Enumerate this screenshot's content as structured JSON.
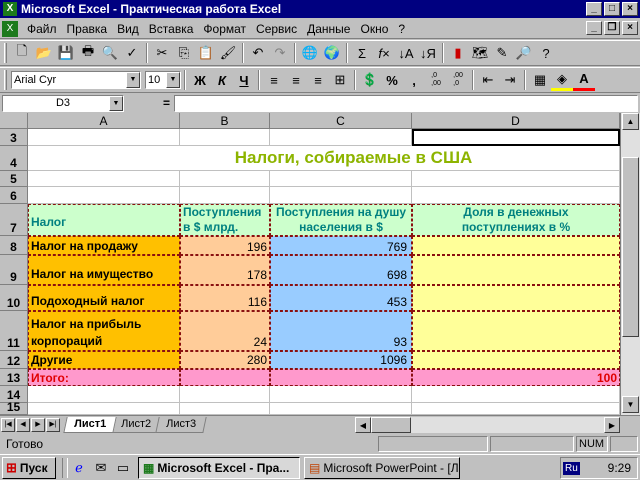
{
  "window": {
    "title": "Microsoft Excel - Практическая работа Excel",
    "app_icon": "excel-icon"
  },
  "menu": [
    "Файл",
    "Правка",
    "Вид",
    "Вставка",
    "Формат",
    "Сервис",
    "Данные",
    "Окно",
    "?"
  ],
  "format_bar": {
    "font": "Arial Cyr",
    "size": "10",
    "bold": "Ж",
    "italic": "К",
    "underline": "Ч",
    "percent": "%",
    "thousands": ",",
    "inc_dec": ",0\n,00",
    "dec_dec": ",00\n,0"
  },
  "formula_bar": {
    "name_box": "D3",
    "equals": "=",
    "value": ""
  },
  "columns": [
    "A",
    "B",
    "C",
    "D"
  ],
  "rows": [
    "3",
    "4",
    "5",
    "6",
    "7",
    "8",
    "9",
    "10",
    "11",
    "12",
    "13",
    "14",
    "15"
  ],
  "sheet": {
    "title": "Налоги, собираемые в США",
    "headers": [
      "Налог",
      "Поступления в $ млрд.",
      "Поступления на душу населения в $",
      "Доля в денежных поступлениях в %"
    ],
    "data": [
      {
        "name": "Налог на продажу",
        "b": "196",
        "c": "769"
      },
      {
        "name": "Налог на имущество",
        "b": "178",
        "c": "698"
      },
      {
        "name": "Подоходный налог",
        "b": "116",
        "c": "453"
      },
      {
        "name": "Налог на прибыль корпораций",
        "b": "24",
        "c": "93"
      },
      {
        "name": "Другие",
        "b": "280",
        "c": "1096"
      }
    ],
    "total": {
      "label": "Итого:",
      "d": "100"
    }
  },
  "colors": {
    "title_green": "#8db400",
    "header_bg": "#ccffcc",
    "header_text": "#008080",
    "orange": "#ffc000",
    "peach": "#ffcc99",
    "blue": "#99ccff",
    "yellow": "#ffff99",
    "pink": "#ff99cc",
    "total_text": "#e00000"
  },
  "tabs": [
    "Лист1",
    "Лист2",
    "Лист3"
  ],
  "status": {
    "text": "Готово",
    "num": "NUM"
  },
  "taskbar": {
    "start": "Пуск",
    "tasks": [
      "Microsoft Excel - Пра...",
      "Microsoft PowerPoint - [Ла..."
    ],
    "lang": "Ru",
    "time": "9:29"
  }
}
